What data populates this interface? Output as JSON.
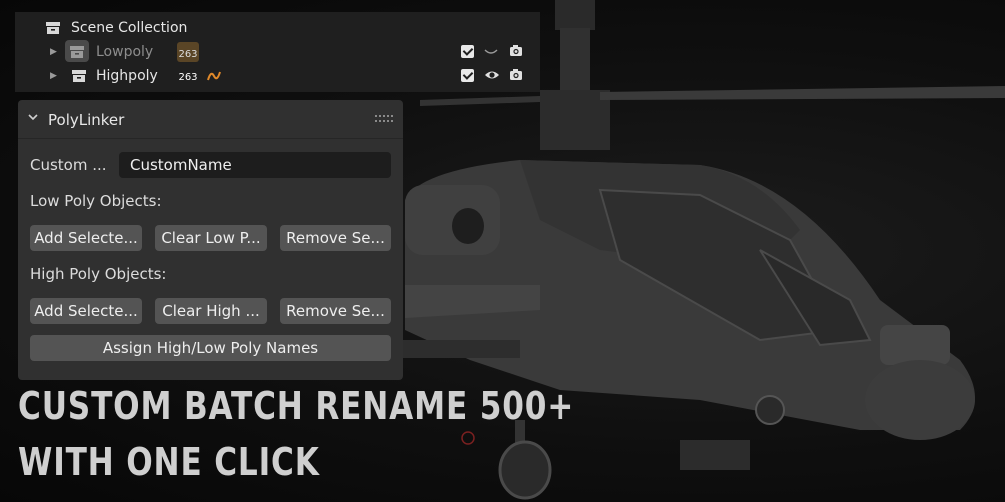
{
  "outliner": {
    "root_label": "Scene Collection",
    "collections": [
      {
        "name": "Lowpoly",
        "count": "263",
        "visible": false,
        "dimmed": true
      },
      {
        "name": "Highpoly",
        "count": "263",
        "visible": true,
        "dimmed": false
      }
    ]
  },
  "panel": {
    "title": "PolyLinker",
    "custom_name_label": "Custom ...",
    "custom_name_value": "CustomName",
    "low_poly_label": "Low Poly Objects:",
    "low_buttons": [
      "Add Selecte...",
      "Clear Low P...",
      "Remove Se..."
    ],
    "high_poly_label": "High Poly Objects:",
    "high_buttons": [
      "Add Selecte...",
      "Clear High ...",
      "Remove Se..."
    ],
    "assign_button": "Assign High/Low Poly Names"
  },
  "caption": {
    "line1": "CUSTOM BATCH RENAME 500+",
    "line2": "WITH ONE CLICK"
  },
  "colors": {
    "panel_bg": "#303030",
    "button_bg": "#545454",
    "field_bg": "#1d1d1d",
    "outliner_bg": "#1f1f1f",
    "badge_orange": "#e0892a"
  }
}
